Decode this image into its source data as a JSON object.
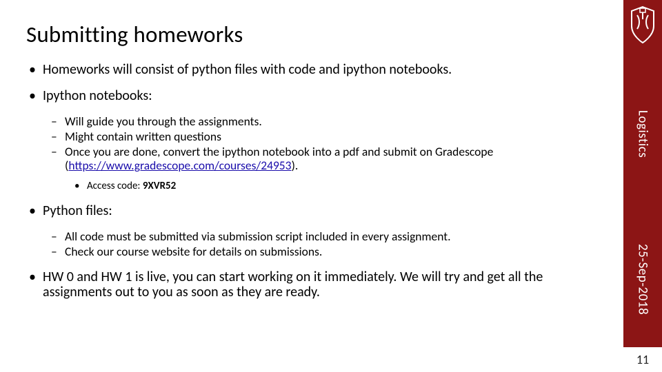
{
  "title": "Submitting homeworks",
  "bullets": {
    "b1": "Homeworks will consist of python files with code and ipython notebooks.",
    "b2": "Ipython notebooks:",
    "b2a": "Will guide you through the assignments.",
    "b2b": "Might contain written questions",
    "b2c_pre": "Once you are done, convert the ipython notebook into a pdf and submit on Gradescope (",
    "b2c_link": "https://www.gradescope.com/courses/24953",
    "b2c_post": ").",
    "b2c1_label": "Access code:  ",
    "b2c1_code": "9XVR52",
    "b3": "Python files:",
    "b3a": "All code must be submitted via submission script included in every assignment.",
    "b3b": "Check our course website for details on submissions.",
    "b4": "HW 0 and HW 1 is live, you can start working on it immediately. We will try and get all the assignments out to you as soon as they are ready."
  },
  "sidebar": {
    "section": "Logistics",
    "date": "25-Sep-2018",
    "page": "11"
  },
  "colors": {
    "brand": "#8c1515"
  }
}
